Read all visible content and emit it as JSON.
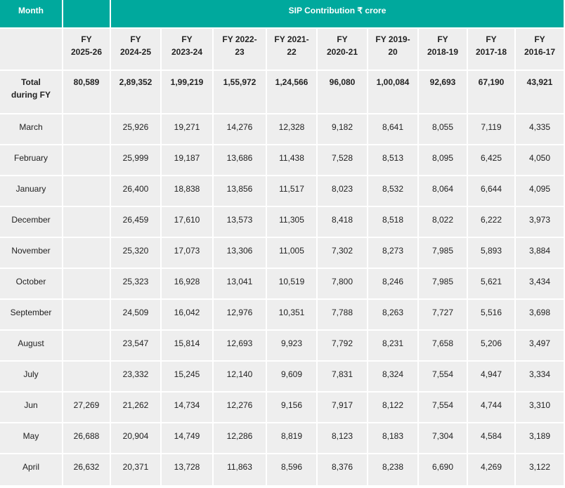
{
  "table": {
    "month_header": "Month",
    "group_header": "SIP Contribution ₹ crore",
    "fy_headers": [
      [
        "FY",
        "2025-26"
      ],
      [
        "FY",
        "2024-25"
      ],
      [
        "FY",
        "2023-24"
      ],
      [
        "FY 2022-",
        "23"
      ],
      [
        "FY 2021-",
        "22"
      ],
      [
        "FY",
        "2020-21"
      ],
      [
        "FY 2019-",
        "20"
      ],
      [
        "FY",
        "2018-19"
      ],
      [
        "FY",
        "2017-18"
      ],
      [
        "FY",
        "2016-17"
      ]
    ],
    "total_label": [
      "Total",
      "during FY"
    ],
    "totals": [
      "80,589",
      "2,89,352",
      "1,99,219",
      "1,55,972",
      "1,24,566",
      "96,080",
      "1,00,084",
      "92,693",
      "67,190",
      "43,921"
    ],
    "rows": [
      {
        "month": "March",
        "values": [
          "",
          "25,926",
          "19,271",
          "14,276",
          "12,328",
          "9,182",
          "8,641",
          "8,055",
          "7,119",
          "4,335"
        ]
      },
      {
        "month": "February",
        "values": [
          "",
          "25,999",
          "19,187",
          "13,686",
          "11,438",
          "7,528",
          "8,513",
          "8,095",
          "6,425",
          "4,050"
        ]
      },
      {
        "month": "January",
        "values": [
          "",
          "26,400",
          "18,838",
          "13,856",
          "11,517",
          "8,023",
          "8,532",
          "8,064",
          "6,644",
          "4,095"
        ]
      },
      {
        "month": "December",
        "values": [
          "",
          "26,459",
          "17,610",
          "13,573",
          "11,305",
          "8,418",
          "8,518",
          "8,022",
          "6,222",
          "3,973"
        ]
      },
      {
        "month": "November",
        "values": [
          "",
          "25,320",
          "17,073",
          "13,306",
          "11,005",
          "7,302",
          "8,273",
          "7,985",
          "5,893",
          "3,884"
        ]
      },
      {
        "month": "October",
        "values": [
          "",
          "25,323",
          "16,928",
          "13,041",
          "10,519",
          "7,800",
          "8,246",
          "7,985",
          "5,621",
          "3,434"
        ]
      },
      {
        "month": "September",
        "values": [
          "",
          "24,509",
          "16,042",
          "12,976",
          "10,351",
          "7,788",
          "8,263",
          "7,727",
          "5,516",
          "3,698"
        ]
      },
      {
        "month": "August",
        "values": [
          "",
          "23,547",
          "15,814",
          "12,693",
          "9,923",
          "7,792",
          "8,231",
          "7,658",
          "5,206",
          "3,497"
        ]
      },
      {
        "month": "July",
        "values": [
          "",
          "23,332",
          "15,245",
          "12,140",
          "9,609",
          "7,831",
          "8,324",
          "7,554",
          "4,947",
          "3,334"
        ]
      },
      {
        "month": "Jun",
        "values": [
          "27,269",
          "21,262",
          "14,734",
          "12,276",
          "9,156",
          "7,917",
          "8,122",
          "7,554",
          "4,744",
          "3,310"
        ]
      },
      {
        "month": "May",
        "values": [
          "26,688",
          "20,904",
          "14,749",
          "12,286",
          "8,819",
          "8,123",
          "8,183",
          "7,304",
          "4,584",
          "3,189"
        ]
      },
      {
        "month": "April",
        "values": [
          "26,632",
          "20,371",
          "13,728",
          "11,863",
          "8,596",
          "8,376",
          "8,238",
          "6,690",
          "4,269",
          "3,122"
        ]
      }
    ],
    "colors": {
      "header_bg": "#00a99d",
      "header_text": "#ffffff",
      "cell_bg": "#eeeeee"
    }
  }
}
